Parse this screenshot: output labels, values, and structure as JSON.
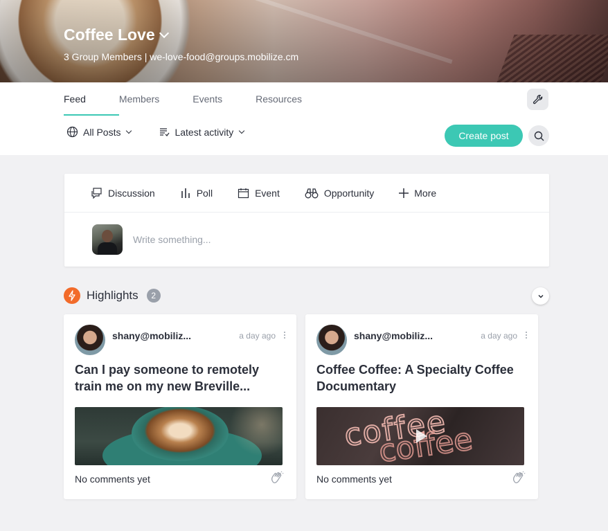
{
  "group": {
    "name": "Coffee Love",
    "subtitle": "3 Group Members | we-love-food@groups.mobilize.cm"
  },
  "tabs": [
    {
      "label": "Feed",
      "active": true
    },
    {
      "label": "Members",
      "active": false
    },
    {
      "label": "Events",
      "active": false
    },
    {
      "label": "Resources",
      "active": false
    }
  ],
  "toolbar": {
    "filter_label": "All Posts",
    "sort_label": "Latest activity",
    "create_label": "Create post"
  },
  "composer": {
    "actions": [
      {
        "label": "Discussion",
        "icon": "discussion-icon"
      },
      {
        "label": "Poll",
        "icon": "poll-icon"
      },
      {
        "label": "Event",
        "icon": "calendar-icon"
      },
      {
        "label": "Opportunity",
        "icon": "binoculars-icon"
      },
      {
        "label": "More",
        "icon": "plus-icon"
      }
    ],
    "placeholder": "Write something..."
  },
  "highlights": {
    "title": "Highlights",
    "count": "2",
    "posts": [
      {
        "author": "shany@mobiliz...",
        "time": "a day ago",
        "title": "Can I pay someone to remotely train me on my new Breville...",
        "comments": "No comments yet"
      },
      {
        "author": "shany@mobiliz...",
        "time": "a day ago",
        "title": "Coffee Coffee: A Specialty Coffee Documentary",
        "comments": "No comments yet"
      }
    ]
  },
  "colors": {
    "accent": "#3cc8b4",
    "highlight_badge": "#f26b2a"
  }
}
